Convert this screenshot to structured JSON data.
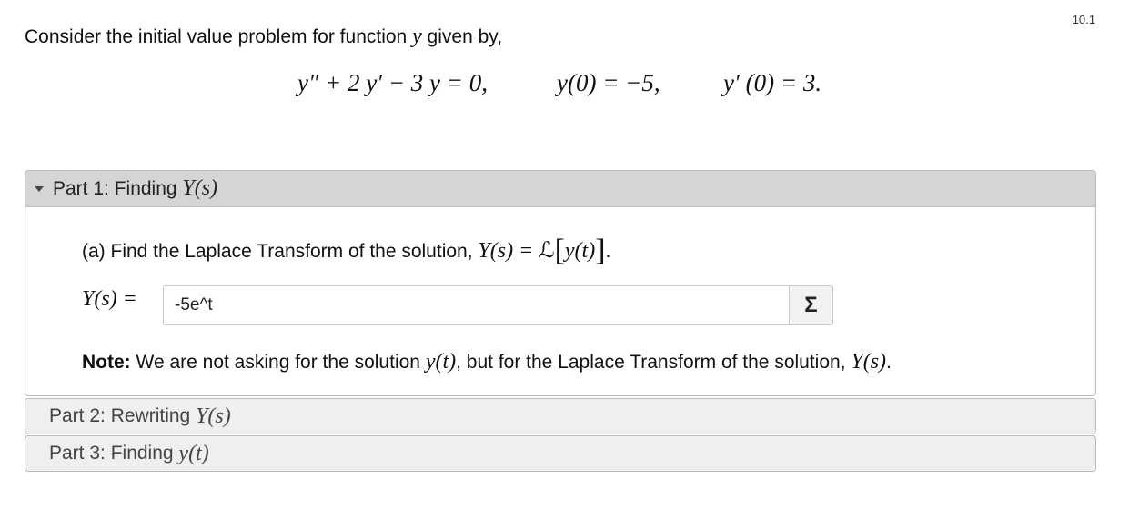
{
  "version": "10.1",
  "intro": {
    "text_before": "Consider the initial value problem for function ",
    "var": "y",
    "text_after": " given by,"
  },
  "equations": {
    "ode": "y″ + 2 y′ − 3 y = 0,",
    "ic1": "y(0) = −5,",
    "ic2": "y′ (0) = 3."
  },
  "parts": [
    {
      "label_prefix": "Part 1: Finding ",
      "label_math": "Y(s)",
      "expanded": true,
      "question": {
        "text": "(a) Find the Laplace Transform of the solution, ",
        "math_lhs": "Y(s) = ",
        "math_script_L": "ℒ",
        "math_inner": "y(t)",
        "end": "."
      },
      "answer": {
        "label": "Y(s) =",
        "value": "-5e^t",
        "sigma_label": "Σ"
      },
      "note": {
        "bold": "Note:",
        "text1": " We are not asking for the solution ",
        "math1": "y(t)",
        "text2": ", but for the Laplace Transform of the solution, ",
        "math2": "Y(s)",
        "end": "."
      }
    },
    {
      "label_prefix": "Part 2: Rewriting ",
      "label_math": "Y(s)",
      "expanded": false
    },
    {
      "label_prefix": "Part 3: Finding ",
      "label_math": "y(t)",
      "expanded": false
    }
  ]
}
